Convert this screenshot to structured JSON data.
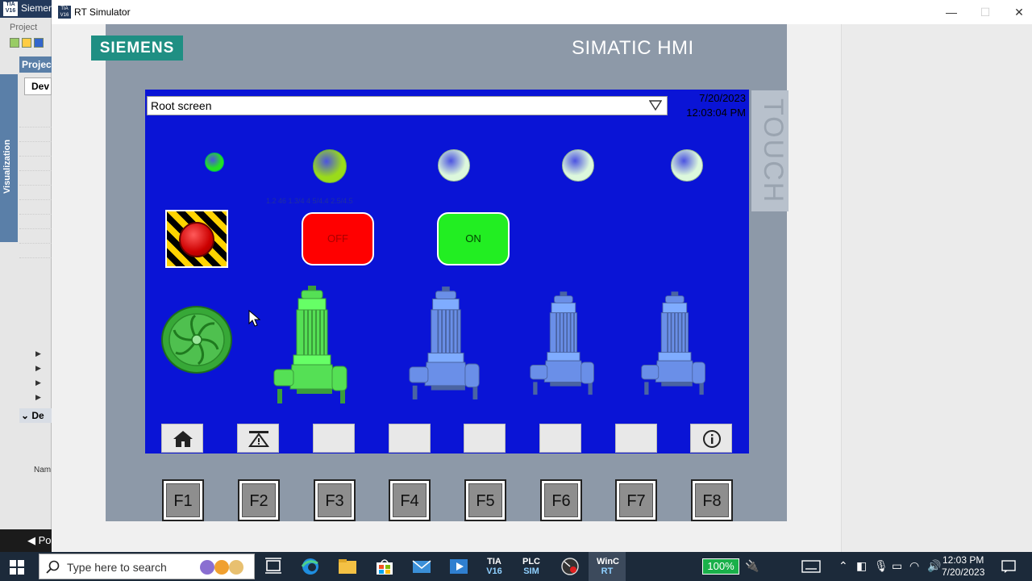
{
  "tia": {
    "app_title": "Siemens",
    "menu_project": "Project",
    "tree_header": "Projec",
    "visualization_label": "Visualization",
    "devices_tab": "Dev",
    "details_header": "De",
    "name_column": "Nam",
    "portal_view": "Po"
  },
  "window": {
    "title": "RT Simulator",
    "minimize": "—",
    "maximize": "☐",
    "close": "✕"
  },
  "hmi": {
    "brand": "SIEMENS",
    "panel_title": "SIMATIC HMI",
    "touch_label": "TOUCH",
    "screen_selector": "Root screen",
    "date": "7/20/2023",
    "time": "12:03:04 PM",
    "faint_label": "1.2 46 1.3/4 4 5/4.4 2.5/4.5",
    "estop_label": "",
    "off_button": "OFF",
    "on_button": "ON",
    "lamps": [
      {
        "state": "on",
        "color": "#22e022"
      },
      {
        "state": "on",
        "color": "#9adb1a"
      },
      {
        "state": "off",
        "color": "#dcf8dc"
      },
      {
        "state": "off",
        "color": "#dcf8dc"
      },
      {
        "state": "off",
        "color": "#dcf8dc"
      }
    ],
    "pumps": [
      {
        "state": "running",
        "color": "#55e055"
      },
      {
        "state": "stopped",
        "color": "#6a8fe8"
      },
      {
        "state": "stopped",
        "color": "#6a8fe8"
      },
      {
        "state": "stopped",
        "color": "#6a8fe8"
      }
    ],
    "softkeys": [
      "home-icon",
      "alarm-icon",
      "",
      "",
      "",
      "",
      "",
      "info-icon"
    ],
    "fkeys": [
      "F1",
      "F2",
      "F3",
      "F4",
      "F5",
      "F6",
      "F7",
      "F8"
    ]
  },
  "taskbar": {
    "search_placeholder": "Type here to search",
    "apps": [
      "TIA V16",
      "PLC SIM",
      "WinCC RT"
    ],
    "tia_line1": "TIA",
    "tia_line2": "V16",
    "plc_line1": "PLC",
    "plc_line2": "SIM",
    "wincc_line1": "WinC",
    "wincc_line2": "RT",
    "battery": "100%",
    "time": "12:03 PM",
    "date": "7/20/2023"
  }
}
